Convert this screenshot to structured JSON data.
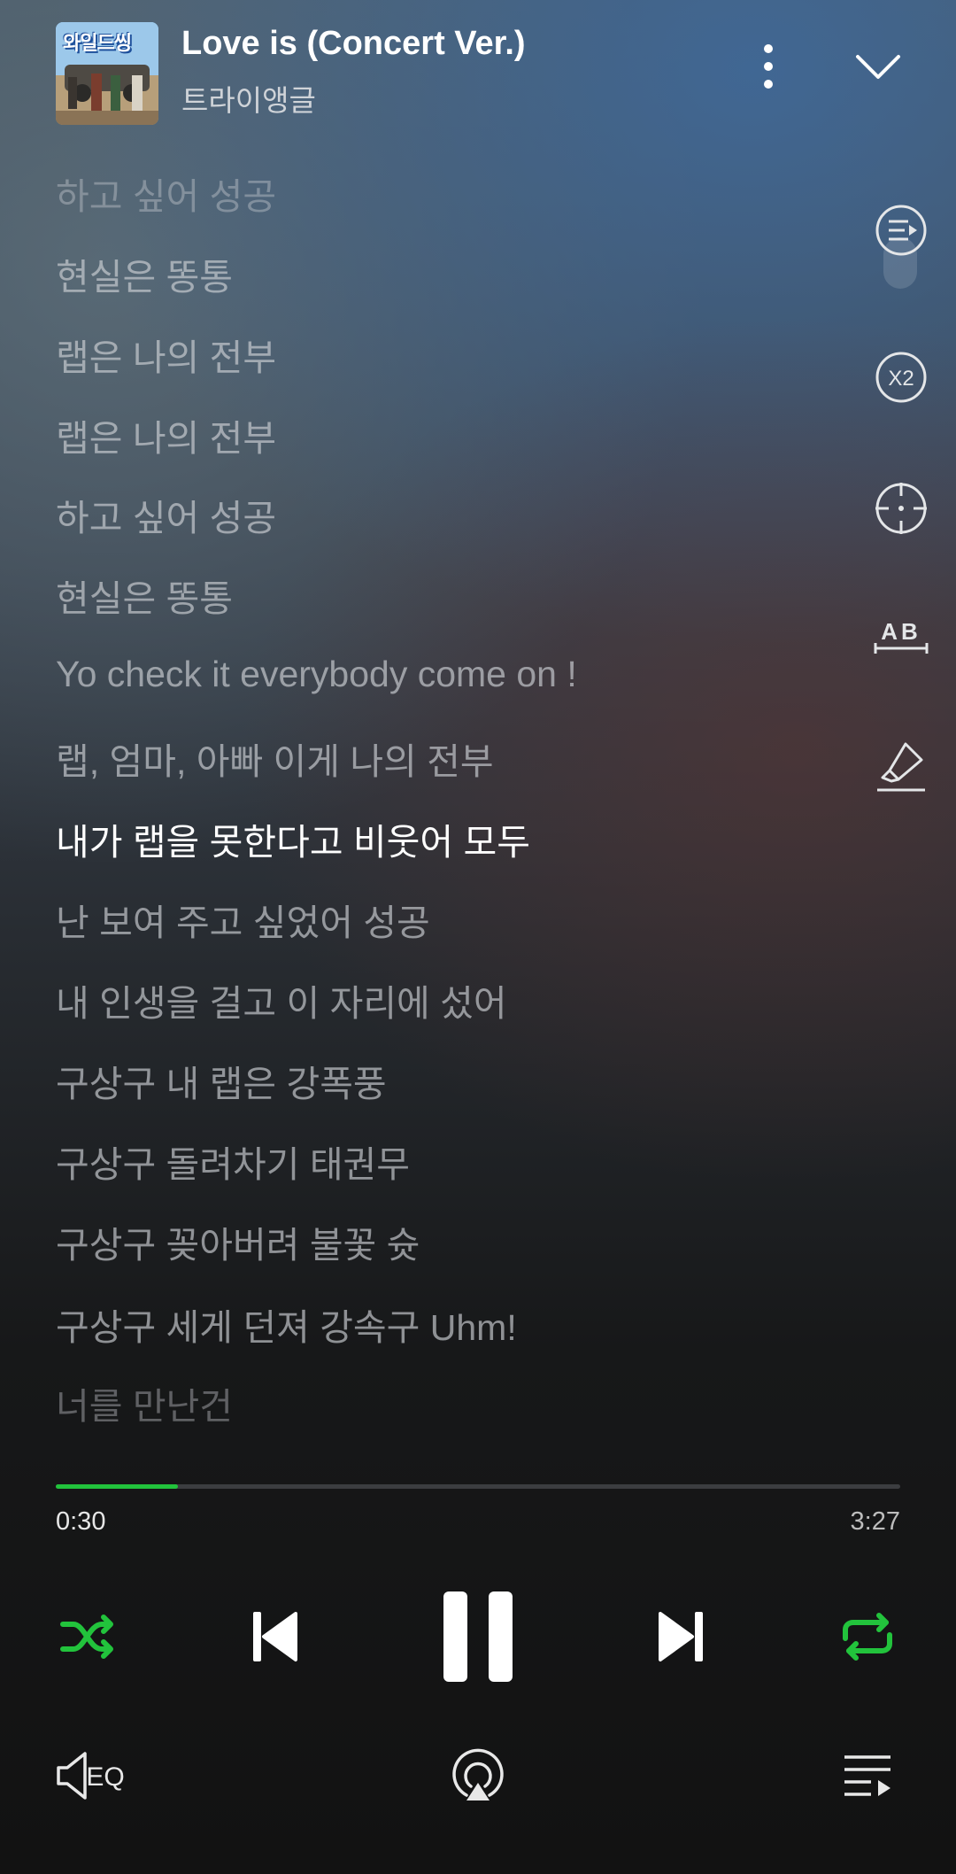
{
  "header": {
    "album_art_text": "와일드씽",
    "title": "Love is (Concert Ver.)",
    "artist": "트라이앵글"
  },
  "side_tools": [
    {
      "name": "lyrics-list-icon"
    },
    {
      "name": "speed-x2-icon",
      "label": "X2"
    },
    {
      "name": "crosshair-icon"
    },
    {
      "name": "font-size-icon",
      "label": "AB"
    },
    {
      "name": "highlighter-icon"
    }
  ],
  "lyrics": [
    "하고 싶어 성공",
    "현실은 똥통",
    "랩은 나의 전부",
    "랩은 나의 전부",
    "하고 싶어 성공",
    "현실은 똥통",
    "Yo check it everybody come on !",
    "랩, 엄마, 아빠 이게 나의 전부",
    "내가 랩을 못한다고 비웃어 모두",
    "난 보여 주고 싶었어 성공",
    "내 인생을 걸고 이 자리에 섰어",
    "구상구 내 랩은 강폭풍",
    "구상구 돌려차기 태권무",
    "구상구 꽂아버려 불꽃 슛",
    "구상구 세게 던져 강속구 Uhm!",
    "너를 만난건"
  ],
  "current_lyric_index": 8,
  "progress": {
    "elapsed": "0:30",
    "duration": "3:27",
    "fraction": 0.145
  },
  "colors": {
    "accent": "#22c33c",
    "current_lyric": "#ffffff",
    "inactive_lyric": "#bfc3c8"
  },
  "controls": {
    "shuffle": "shuffle-icon",
    "previous": "skip-previous-icon",
    "play_pause": "pause-icon",
    "next": "skip-next-icon",
    "repeat": "repeat-icon"
  },
  "bottom_bar": {
    "eq_label": "EQ",
    "cast": "cast-icon",
    "playlist": "playlist-icon"
  }
}
